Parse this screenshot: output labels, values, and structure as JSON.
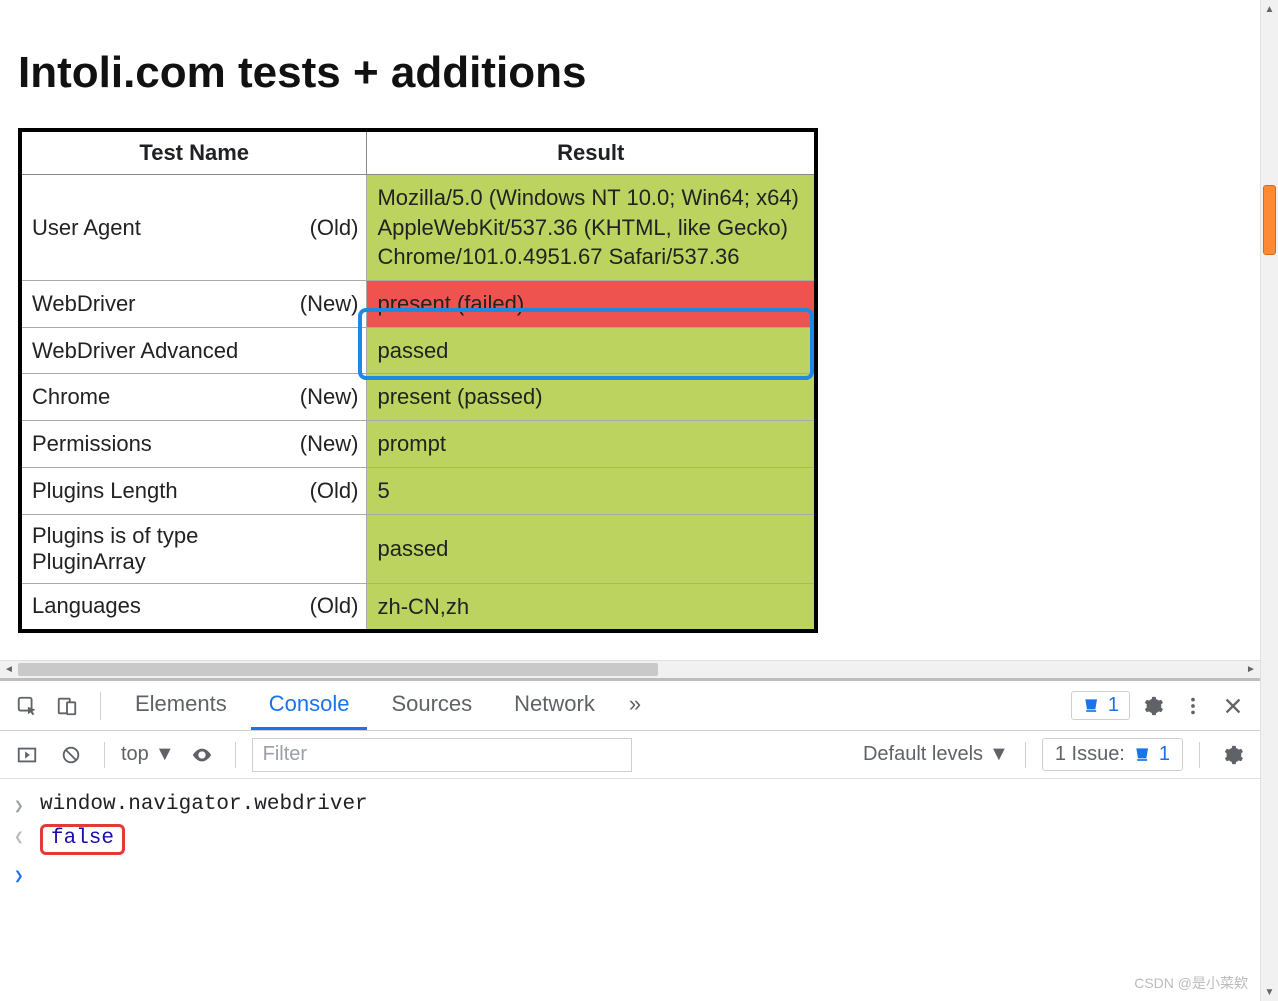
{
  "page": {
    "title": "Intoli.com tests + additions",
    "table": {
      "headers": {
        "name": "Test Name",
        "result": "Result"
      },
      "rows": [
        {
          "name": "User Agent",
          "age": "(Old)",
          "result": "Mozilla/5.0 (Windows NT 10.0; Win64; x64) AppleWebKit/537.36 (KHTML, like Gecko) Chrome/101.0.4951.67 Safari/537.36",
          "status": "pass"
        },
        {
          "name": "WebDriver",
          "age": "(New)",
          "result": "present (failed)",
          "status": "fail"
        },
        {
          "name": "WebDriver Advanced",
          "age": "",
          "result": "passed",
          "status": "pass"
        },
        {
          "name": "Chrome",
          "age": "(New)",
          "result": "present (passed)",
          "status": "pass"
        },
        {
          "name": "Permissions",
          "age": "(New)",
          "result": "prompt",
          "status": "pass"
        },
        {
          "name": "Plugins Length",
          "age": "(Old)",
          "result": "5",
          "status": "pass"
        },
        {
          "name": "Plugins is of type PluginArray",
          "age": "",
          "result": "passed",
          "status": "pass"
        },
        {
          "name": "Languages",
          "age": "(Old)",
          "result": "zh-CN,zh",
          "status": "pass"
        }
      ]
    }
  },
  "devtools": {
    "tabs": {
      "elements": "Elements",
      "console": "Console",
      "sources": "Sources",
      "network": "Network",
      "more": "»"
    },
    "errors_count": "1",
    "toolbar": {
      "context": "top",
      "filter_placeholder": "Filter",
      "levels": "Default levels",
      "issues_label": "1 Issue:",
      "issues_count": "1"
    },
    "console": {
      "input": "window.navigator.webdriver",
      "output": "false"
    }
  },
  "watermark": "CSDN @是小菜欸",
  "colors": {
    "pass_bg": "#bcd35f",
    "fail_bg": "#ef5350",
    "accent": "#1a73e8",
    "highlight": "#1e88e5",
    "redbox": "#e53935"
  }
}
